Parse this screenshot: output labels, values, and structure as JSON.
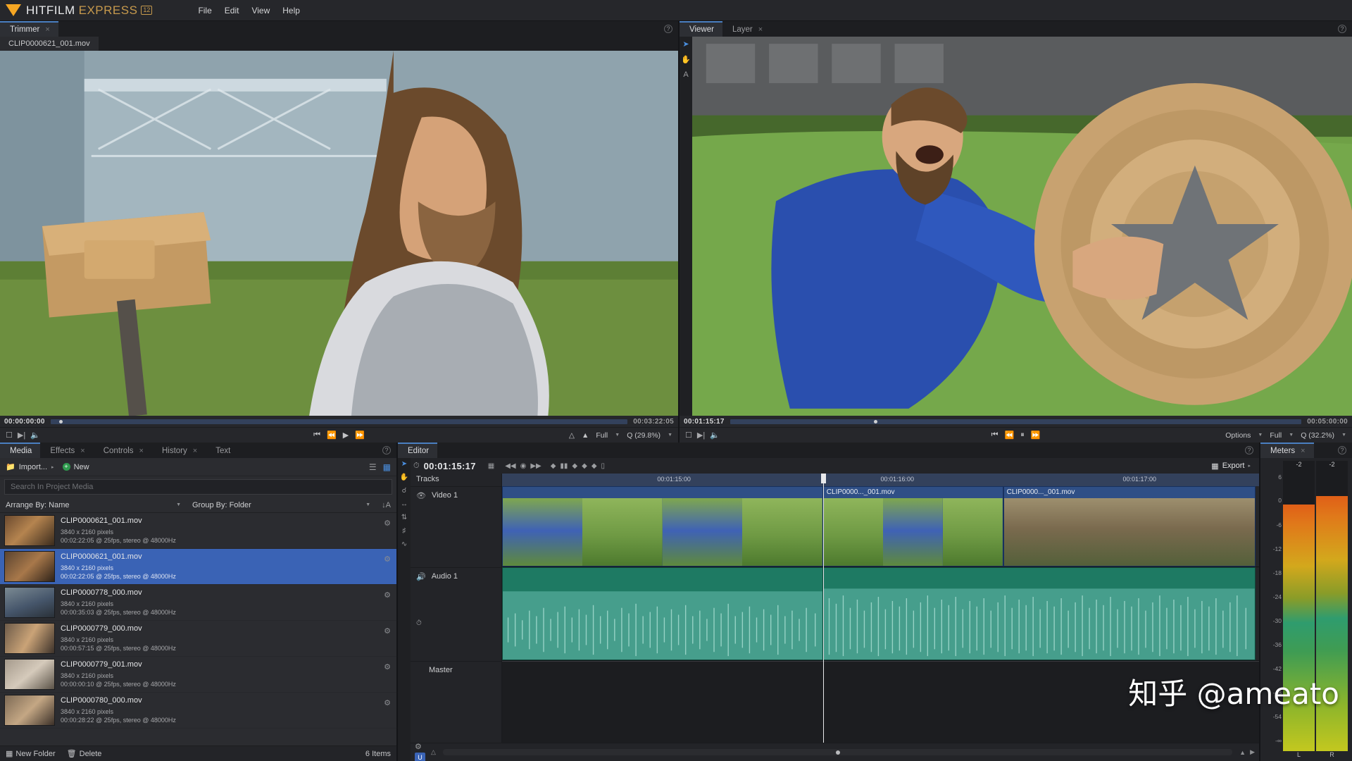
{
  "app": {
    "brand_first": "HITFILM",
    "brand_second": "EXPRESS",
    "version_badge": "12",
    "accent_orange": "#f5a623",
    "accent_gold": "#c79a4d",
    "selection_blue": "#3a63b5",
    "menu": [
      "File",
      "Edit",
      "View",
      "Help"
    ]
  },
  "trimmer": {
    "tab_label": "Trimmer",
    "close_glyph": "×",
    "clip_tab": "CLIP0000621_001.mov",
    "current_timecode": "00:00:00:00",
    "duration_timecode": "00:03:22:05",
    "playhead_pct": 1.5,
    "left_icons": [
      "loop-icon",
      "export-frame-icon",
      "audio-icon"
    ],
    "transport": [
      "⏮",
      "⏪",
      "▶",
      "⏩"
    ],
    "right_controls": {
      "marker_in": "mark-in-icon",
      "marker_out": "mark-out-icon",
      "quality_label": "Full",
      "zoom_label": "Q (29.8%)"
    },
    "help_glyph": "?"
  },
  "viewer": {
    "tabs": [
      {
        "label": "Viewer",
        "active": true,
        "closable": false
      },
      {
        "label": "Layer",
        "active": false,
        "closable": true
      }
    ],
    "tools": [
      "select-arrow-icon",
      "hand-icon",
      "text-tool-icon"
    ],
    "current_timecode": "00:01:15:17",
    "duration_timecode": "00:05:00:00",
    "playhead_pct": 25.2,
    "left_icons": [
      "loop-icon",
      "export-frame-icon",
      "audio-icon"
    ],
    "transport": [
      "⏮",
      "⏪",
      "⏸",
      "⏩"
    ],
    "right_controls": {
      "options_label": "Options",
      "quality_label": "Full",
      "zoom_label": "Q (32.2%)"
    },
    "help_glyph": "?"
  },
  "media_panel": {
    "tabs": [
      {
        "label": "Media",
        "active": true,
        "closable": false
      },
      {
        "label": "Effects",
        "active": false,
        "closable": true
      },
      {
        "label": "Controls",
        "active": false,
        "closable": true
      },
      {
        "label": "History",
        "active": false,
        "closable": true
      },
      {
        "label": "Text",
        "active": false,
        "closable": false
      }
    ],
    "toolbar": {
      "import_label": "Import...",
      "import_caret": "▸",
      "new_label": "New",
      "new_plus": "+",
      "view_list_icon": "list-view-icon",
      "view_detail_icon": "detail-view-icon"
    },
    "search_placeholder": "Search In Project Media",
    "arrange_label": "Arrange By: Name",
    "group_label": "Group By: Folder",
    "sort_icon": "sort-az-icon",
    "items": [
      {
        "name": "CLIP0000621_001.mov",
        "resolution": "3840 x 2160 pixels",
        "meta": "00:02:22:05 @ 25fps, stereo @ 48000Hz",
        "selected": false,
        "thumb": "th1"
      },
      {
        "name": "CLIP0000621_001.mov",
        "resolution": "3840 x 2160 pixels",
        "meta": "00:02:22:05 @ 25fps, stereo @ 48000Hz",
        "selected": true,
        "thumb": "th2"
      },
      {
        "name": "CLIP0000778_000.mov",
        "resolution": "3840 x 2160 pixels",
        "meta": "00:00:35:03 @ 25fps, stereo @ 48000Hz",
        "selected": false,
        "thumb": "th3"
      },
      {
        "name": "CLIP0000779_000.mov",
        "resolution": "3840 x 2160 pixels",
        "meta": "00:00:57:15 @ 25fps, stereo @ 48000Hz",
        "selected": false,
        "thumb": "th4"
      },
      {
        "name": "CLIP0000779_001.mov",
        "resolution": "3840 x 2160 pixels",
        "meta": "00:00:00:10 @ 25fps, stereo @ 48000Hz",
        "selected": false,
        "thumb": "th5"
      },
      {
        "name": "CLIP0000780_000.mov",
        "resolution": "3840 x 2160 pixels",
        "meta": "00:00:28:22 @ 25fps, stereo @ 48000Hz",
        "selected": false,
        "thumb": "th6"
      }
    ],
    "footer": {
      "new_folder_label": "New Folder",
      "delete_label": "Delete",
      "count_label": "6 Items"
    }
  },
  "editor": {
    "tab_label": "Editor",
    "help_glyph": "?",
    "timecode": "00:01:15:17",
    "clock_icon": "clock-icon",
    "toolbar_icons": [
      "new-track-icon",
      "prev-edit-icon",
      "record-icon",
      "next-edit-icon",
      "keyframe-prev-icon",
      "pause-key-icon",
      "keyframe-icon",
      "keyframe-add-icon",
      "keyframe-next-icon",
      "keyframe-end-icon"
    ],
    "export_label": "Export",
    "export_caret": "▸",
    "tools": [
      "select-arrow-icon",
      "hand-icon",
      "slip-icon",
      "slide-icon",
      "stretch-icon",
      "razor-icon",
      "rate-icon"
    ],
    "tracks_header": "Tracks",
    "tracks": [
      {
        "name": "Video 1",
        "icon": "eye-icon",
        "type": "video"
      },
      {
        "name": "Audio 1",
        "icon": "speaker-icon",
        "type": "audio",
        "extra_icon": "waveform-icon"
      },
      {
        "name": "Master",
        "icon": "",
        "type": "master"
      }
    ],
    "ruler_ticks": [
      "00:01:15:00",
      "00:01:16:00",
      "00:01:17:00"
    ],
    "video_clips": [
      {
        "label": "",
        "left_pct": 0.0,
        "width_pct": 42.4,
        "strip": "fs-b"
      },
      {
        "label": "CLIP0000..._001.mov",
        "left_pct": 42.4,
        "width_pct": 23.8,
        "strip": "fs-a"
      },
      {
        "label": "CLIP0000..._001.mov",
        "left_pct": 66.2,
        "width_pct": 33.3,
        "strip": "fs-c"
      }
    ],
    "audio_clips": [
      {
        "left_pct": 0.0,
        "width_pct": 42.4
      },
      {
        "left_pct": 42.4,
        "width_pct": 57.1
      }
    ],
    "playhead_pct": 42.4,
    "footer": {
      "settings_icon": "gear-icon",
      "magnet_icon": "magnet-icon",
      "magnet_label": "U"
    }
  },
  "meters": {
    "tab_label": "Meters",
    "help_glyph": "?",
    "scale": [
      "6",
      "0",
      "-6",
      "-12",
      "-18",
      "-24",
      "-30",
      "-36",
      "-42",
      "-48",
      "-54",
      "-∞"
    ],
    "channels": [
      {
        "label": "L",
        "value": "-2",
        "level_pct": 88
      },
      {
        "label": "R",
        "value": "-2",
        "level_pct": 91
      }
    ]
  },
  "watermark": {
    "text": "知乎 @ameato"
  }
}
